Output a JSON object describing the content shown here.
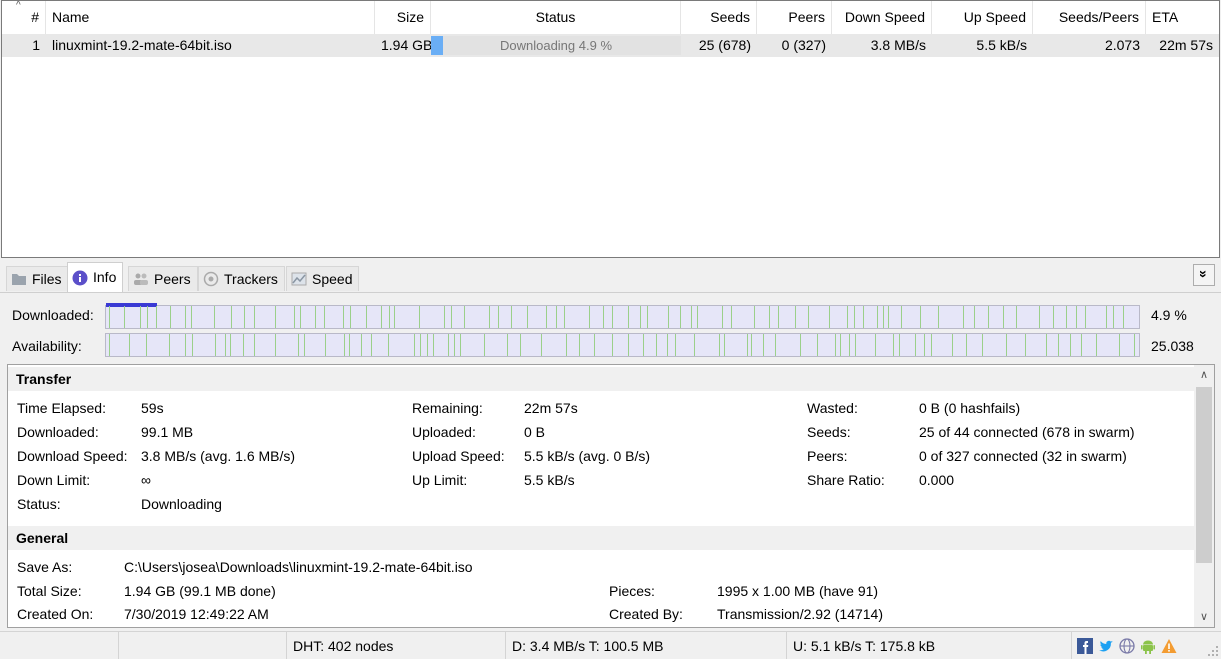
{
  "columns": {
    "num": "#",
    "name": "Name",
    "size": "Size",
    "status": "Status",
    "seeds": "Seeds",
    "peers": "Peers",
    "down_speed": "Down Speed",
    "up_speed": "Up Speed",
    "ratio": "Seeds/Peers",
    "eta": "ETA"
  },
  "torrents": [
    {
      "num": "1",
      "name": "linuxmint-19.2-mate-64bit.iso",
      "size": "1.94 GB",
      "status": "Downloading 4.9 %",
      "progress": 0.049,
      "seeds": "25 (678)",
      "peers": "0 (327)",
      "down_speed": "3.8 MB/s",
      "up_speed": "5.5 kB/s",
      "ratio": "2.073",
      "eta": "22m 57s"
    }
  ],
  "tabs": {
    "files": "Files",
    "info": "Info",
    "peers": "Peers",
    "trackers": "Trackers",
    "speed": "Speed"
  },
  "collapse_glyph": "»",
  "bars": {
    "downloaded_label": "Downloaded:",
    "downloaded_value": "4.9 %",
    "downloaded_progress": 0.049,
    "availability_label": "Availability:",
    "availability_value": "25.038"
  },
  "transfer": {
    "title": "Transfer",
    "time_elapsed_label": "Time Elapsed:",
    "time_elapsed": "59s",
    "downloaded_label": "Downloaded:",
    "downloaded": "99.1 MB",
    "download_speed_label": "Download Speed:",
    "download_speed": "3.8 MB/s (avg. 1.6 MB/s)",
    "down_limit_label": "Down Limit:",
    "down_limit": "∞",
    "status_label": "Status:",
    "status": "Downloading",
    "remaining_label": "Remaining:",
    "remaining": "22m 57s",
    "uploaded_label": "Uploaded:",
    "uploaded": "0 B",
    "upload_speed_label": "Upload Speed:",
    "upload_speed": "5.5 kB/s (avg. 0 B/s)",
    "up_limit_label": "Up Limit:",
    "up_limit": "5.5 kB/s",
    "wasted_label": "Wasted:",
    "wasted": "0 B (0 hashfails)",
    "seeds_label": "Seeds:",
    "seeds": "25 of 44 connected (678 in swarm)",
    "peers_label": "Peers:",
    "peers": "0 of 327 connected (32 in swarm)",
    "share_ratio_label": "Share Ratio:",
    "share_ratio": "0.000"
  },
  "general": {
    "title": "General",
    "save_as_label": "Save As:",
    "save_as": "C:\\Users\\josea\\Downloads\\linuxmint-19.2-mate-64bit.iso",
    "total_size_label": "Total Size:",
    "total_size": "1.94 GB (99.1 MB done)",
    "created_on_label": "Created On:",
    "created_on": "7/30/2019 12:49:22 AM",
    "pieces_label": "Pieces:",
    "pieces": "1995 x 1.00 MB (have 91)",
    "created_by_label": "Created By:",
    "created_by": "Transmission/2.92 (14714)"
  },
  "statusbar": {
    "dht": "DHT: 402 nodes",
    "down": "D: 3.4 MB/s T: 100.5 MB",
    "up": "U: 5.1 kB/s T: 175.8 kB"
  },
  "colors": {
    "progress_fill": "#6aaef5",
    "downloaded_fill": "#3a3ad4",
    "piece_stripe": "#9bd08a",
    "info_icon": "#5b4fc9"
  }
}
